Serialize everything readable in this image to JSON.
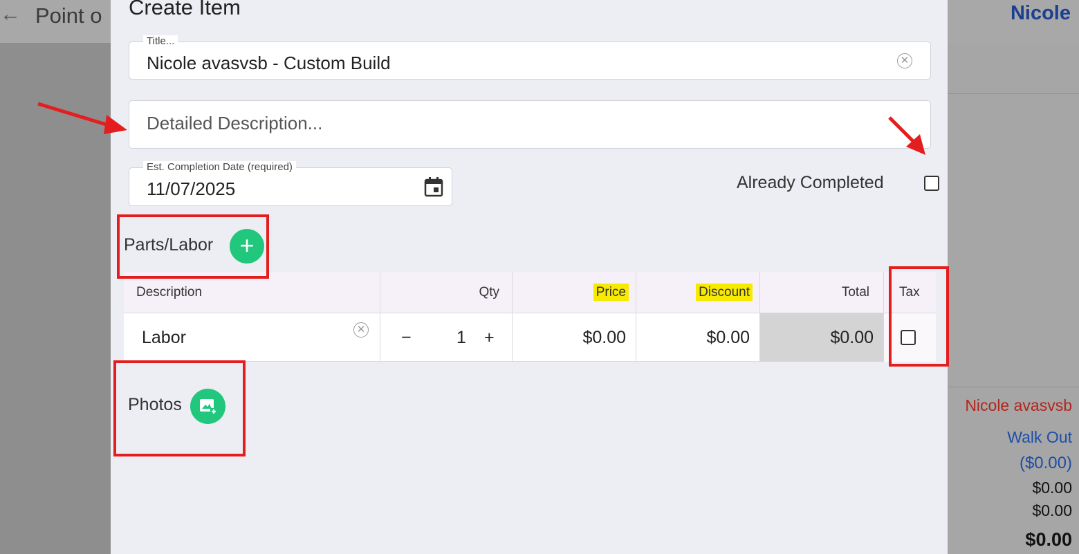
{
  "background": {
    "back_glyph": "←",
    "title": "Point o",
    "user": "Nicole",
    "customer_name": "Nicole avasvsb",
    "walk_out_label": "Walk Out",
    "walk_out_amount": "($0.00)",
    "values": [
      "$0.00",
      "$0.00",
      "$0.00"
    ]
  },
  "modal": {
    "title": "Create Item",
    "title_field": {
      "label": "Title...",
      "value": "Nicole avasvsb - Custom Build"
    },
    "description_field": {
      "placeholder": "Detailed Description..."
    },
    "date_field": {
      "label": "Est. Completion Date (required)",
      "value": "11/07/2025"
    },
    "already_completed": {
      "label": "Already Completed",
      "checked": false
    },
    "parts_labor": {
      "label": "Parts/Labor",
      "add_glyph": "+"
    },
    "table": {
      "headers": {
        "description": "Description",
        "qty": "Qty",
        "price": "Price",
        "discount": "Discount",
        "total": "Total",
        "tax": "Tax"
      },
      "rows": [
        {
          "description": "Labor",
          "qty": "1",
          "minus": "−",
          "plus": "+",
          "price": "$0.00",
          "discount": "$0.00",
          "total": "$0.00",
          "tax": false
        }
      ]
    },
    "photos": {
      "label": "Photos"
    }
  },
  "colors": {
    "accent_green": "#21c77d",
    "annotation_red": "#e41e1e",
    "highlight_yellow": "#f7ea00",
    "link_blue": "#1c3f8f"
  }
}
